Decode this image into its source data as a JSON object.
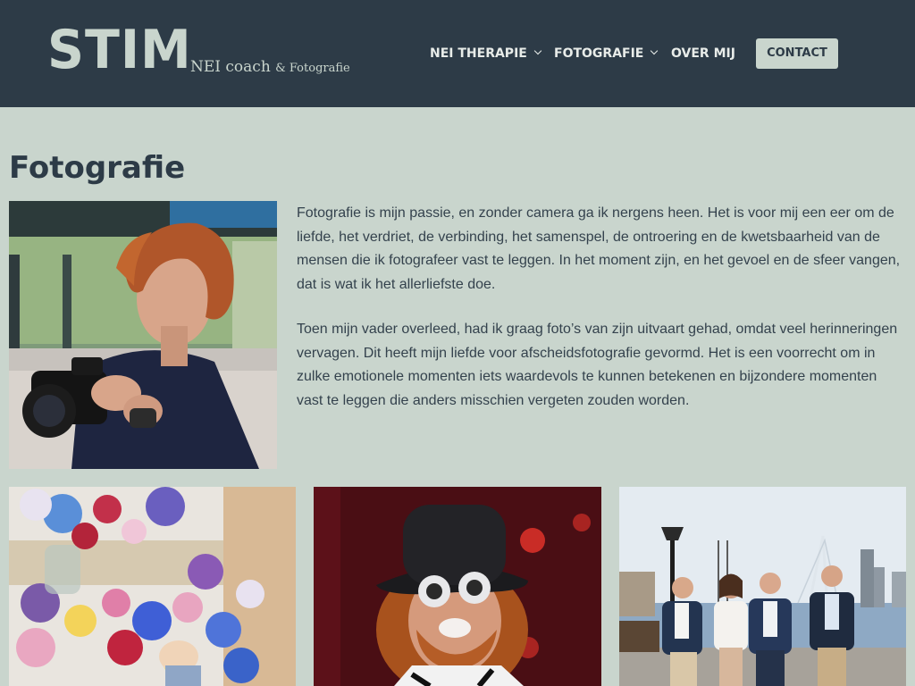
{
  "header": {
    "logo": {
      "mark": "STIM",
      "subtitle_main": "NEI coach",
      "subtitle_amp": "& Fotografie"
    },
    "nav": [
      {
        "label": "NEI THERAPIE",
        "has_dropdown": true
      },
      {
        "label": "FOTOGRAFIE",
        "has_dropdown": true
      },
      {
        "label": "OVER MIJ",
        "has_dropdown": false
      }
    ],
    "contact_label": "CONTACT"
  },
  "main": {
    "title": "Fotografie",
    "paragraphs": [
      "Fotografie is mijn passie, en zonder camera ga ik nergens heen. Het is voor mij een eer om de liefde, het verdriet, de verbinding, het samenspel, de ontroering en de kwetsbaarheid van de mensen die ik fotografeer vast te leggen. In het moment zijn, en het gevoel en de sfeer vangen, dat is wat ik het allerliefste doe.",
      "Toen mijn vader overleed, had ik graag foto’s van zijn uitvaart gehad, omdat veel herinneringen vervagen. Dit heeft mijn liefde voor afscheidsfotografie gevormd. Het is een voorrecht om in zulke emotionele momenten iets waardevols te kunnen betekenen en bijzondere momenten vast te leggen die anders misschien vergeten zouden worden."
    ]
  },
  "colors": {
    "header_bg": "#2d3b47",
    "page_bg": "#c9d5cd",
    "accent": "#c9d5cd",
    "text": "#34424d"
  }
}
